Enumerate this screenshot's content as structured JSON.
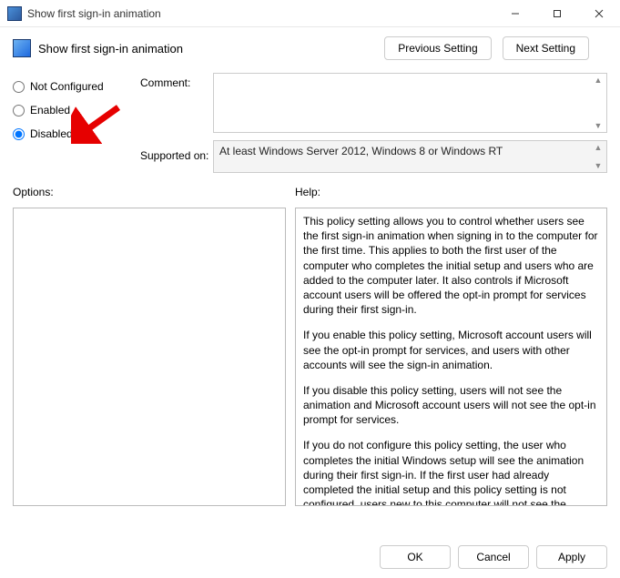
{
  "window": {
    "title": "Show first sign-in animation"
  },
  "header": {
    "title": "Show first sign-in animation",
    "prev": "Previous Setting",
    "next": "Next Setting"
  },
  "radios": {
    "not_configured": "Not Configured",
    "enabled": "Enabled",
    "disabled": "Disabled",
    "selected": "disabled"
  },
  "labels": {
    "comment": "Comment:",
    "supported": "Supported on:",
    "options": "Options:",
    "help": "Help:"
  },
  "fields": {
    "comment": "",
    "supported": "At least Windows Server 2012, Windows 8 or Windows RT"
  },
  "help": {
    "p1": "This policy setting allows you to control whether users see the first sign-in animation when signing in to the computer for the first time.  This applies to both the first user of the computer who completes the initial setup and users who are added to the computer later.  It also controls if Microsoft account users will be offered the opt-in prompt for services during their first sign-in.",
    "p2": "If you enable this policy setting, Microsoft account users will see the opt-in prompt for services, and users with other accounts will see the sign-in animation.",
    "p3": "If you disable this policy setting, users will not see the animation and Microsoft account users will not see the opt-in prompt for services.",
    "p4": "If you do not configure this policy setting, the user who completes the initial Windows setup will see the animation during their first sign-in. If the first user had already completed the initial setup and this policy setting is not configured, users new to this computer will not see the animation."
  },
  "footer": {
    "ok": "OK",
    "cancel": "Cancel",
    "apply": "Apply"
  }
}
